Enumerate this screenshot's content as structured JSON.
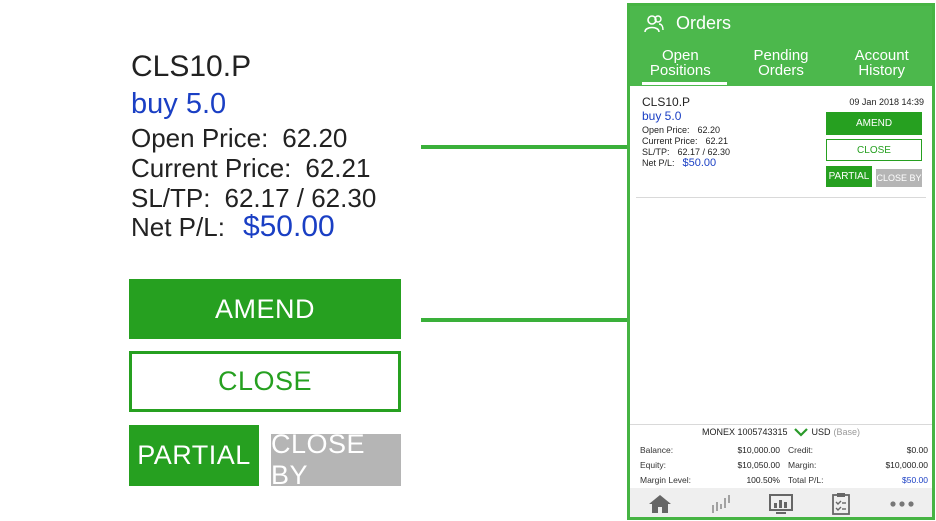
{
  "zoom": {
    "symbol": "CLS10.P",
    "side": "buy 5.0",
    "open_price_label": "Open Price:",
    "open_price": "62.20",
    "current_price_label": "Current Price:",
    "current_price": "62.21",
    "sltp_label": "SL/TP:",
    "sltp": "62.17 / 62.30",
    "net_pl_label": "Net P/L:",
    "net_pl": "$50.00",
    "amend_label": "AMEND",
    "close_label": "CLOSE",
    "partial_label": "PARTIAL",
    "close_by_label": "CLOSE BY"
  },
  "phone": {
    "title": "Orders",
    "tabs": [
      {
        "line1": "Open",
        "line2": "Positions",
        "active": true
      },
      {
        "line1": "Pending",
        "line2": "Orders",
        "active": false
      },
      {
        "line1": "Account",
        "line2": "History",
        "active": false
      }
    ],
    "position": {
      "symbol": "CLS10.P",
      "date": "09 Jan 2018 14:39",
      "side": "buy 5.0",
      "open_price_label": "Open Price:",
      "open_price": "62.20",
      "current_price_label": "Current Price:",
      "current_price": "62.21",
      "sltp_label": "SL/TP:",
      "sltp": "62.17 / 62.30",
      "net_pl_label": "Net P/L:",
      "net_pl": "$50.00",
      "amend_label": "AMEND",
      "close_label": "CLOSE",
      "partial_label": "PARTIAL",
      "close_by_label": "CLOSE BY"
    },
    "account": {
      "name": "MONEX 1005743315",
      "currency": "USD",
      "currency_note": "(Base)",
      "balance_label": "Balance:",
      "balance": "$10,000.00",
      "credit_label": "Credit:",
      "credit": "$0.00",
      "equity_label": "Equity:",
      "equity": "$10,050.00",
      "margin_label": "Margin:",
      "margin": "$10,000.00",
      "margin_level_label": "Margin Level:",
      "margin_level": "100.50%",
      "total_pl_label": "Total P/L:",
      "total_pl": "$50.00"
    },
    "nav_icons": [
      "home-icon",
      "chart-icon",
      "monitor-icon",
      "clipboard-icon",
      "more-icon"
    ]
  },
  "colors": {
    "brand_green": "#4cb84c",
    "button_green": "#26a020",
    "value_blue": "#1a3fc4",
    "disabled_gray": "#b5b5b5"
  }
}
